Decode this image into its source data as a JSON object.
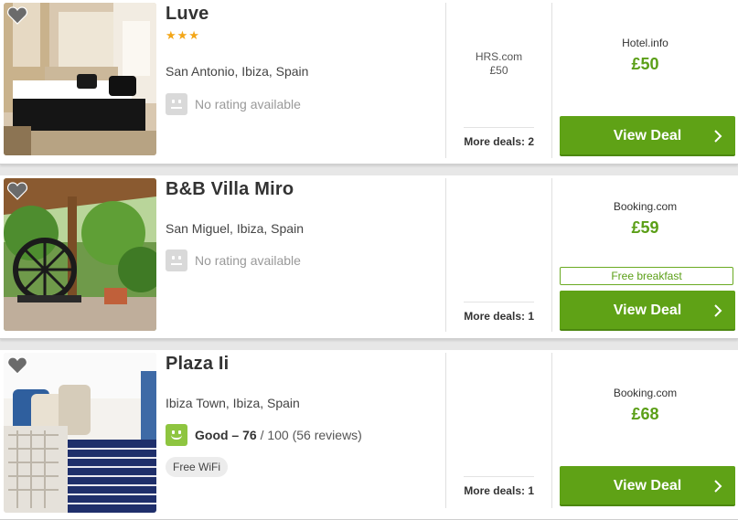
{
  "hotels": [
    {
      "name": "Luve",
      "stars": "★★★",
      "location": "San Antonio, Ibiza, Spain",
      "rating_text": "No rating available",
      "alt_provider": "HRS.com",
      "alt_price": "£50",
      "more_deals": "More deals: 2",
      "deal_provider": "Hotel.info",
      "deal_price": "£50",
      "cta": "View Deal"
    },
    {
      "name": "B&B Villa Miro",
      "location": "San Miguel, Ibiza, Spain",
      "rating_text": "No rating available",
      "more_deals": "More deals: 1",
      "deal_provider": "Booking.com",
      "deal_price": "£59",
      "badge": "Free breakfast",
      "cta": "View Deal"
    },
    {
      "name": "Plaza Ii",
      "location": "Ibiza Town, Ibiza, Spain",
      "rating_label": "Good – 76",
      "rating_rest": " / 100 (56 reviews)",
      "amenity": "Free WiFi",
      "more_deals": "More deals: 1",
      "deal_provider": "Booking.com",
      "deal_price": "£68",
      "cta": "View Deal"
    }
  ],
  "colors": {
    "price_green": "#5b9f17",
    "button_green": "#5fa216",
    "star": "#f3a618",
    "good_rating": "#8ec540"
  },
  "icons": {
    "favorite": "heart-icon",
    "chevron": "chevron-right-icon",
    "no_rating": "neutral-face-icon",
    "good_rating": "smile-face-icon"
  }
}
